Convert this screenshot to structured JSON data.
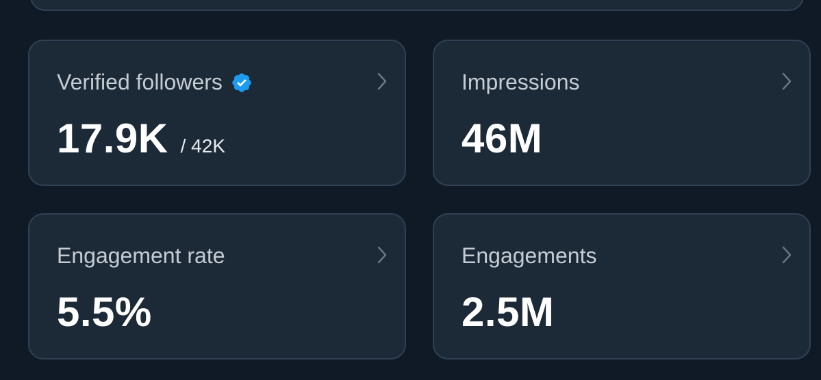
{
  "stats": [
    {
      "id": "verified-followers",
      "title": "Verified followers",
      "verified_badge": true,
      "value": "17.9K",
      "sub_value": "/ 42K"
    },
    {
      "id": "impressions",
      "title": "Impressions",
      "verified_badge": false,
      "value": "46M",
      "sub_value": ""
    },
    {
      "id": "engagement-rate",
      "title": "Engagement rate",
      "verified_badge": false,
      "value": "5.5%",
      "sub_value": ""
    },
    {
      "id": "engagements",
      "title": "Engagements",
      "verified_badge": false,
      "value": "2.5M",
      "sub_value": ""
    }
  ],
  "icons": {
    "verified": "verified-badge-icon",
    "chevron": "chevron-right-icon"
  },
  "colors": {
    "background": "#0f1a26",
    "card": "#1c2a38",
    "card_border": "#2f4153",
    "verified_blue": "#1d9bf0",
    "title_text": "#c5ccd4",
    "value_text": "#ffffff"
  }
}
